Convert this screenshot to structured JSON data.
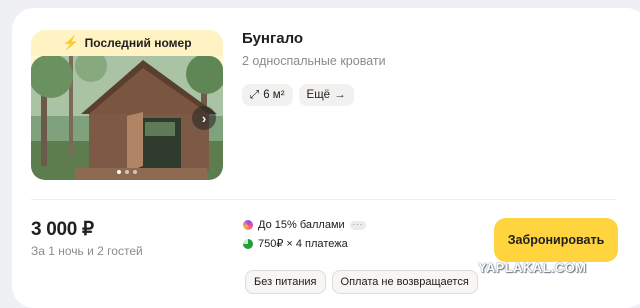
{
  "offer": {
    "badge_label": "Последний номер",
    "title": "Бунгало",
    "subtitle": "2 односпальные кровати",
    "area_label": "6 м²",
    "more_label": "Ещё",
    "price": "3 000 ₽",
    "price_note": "За 1 ночь и 2 гостей",
    "promo_points": "До 15% баллами",
    "promo_installments": "750₽ × 4 платежа",
    "tags": [
      "Без питания",
      "Оплата не возвращается"
    ],
    "book_label": "Забронировать"
  },
  "gallery": {
    "photos_total": 3,
    "active_photo": 1
  },
  "watermark": "YAPLAKAL.COM",
  "colors": {
    "accent_button": "#ffd43f",
    "badge_bg": "#fff3c4"
  }
}
